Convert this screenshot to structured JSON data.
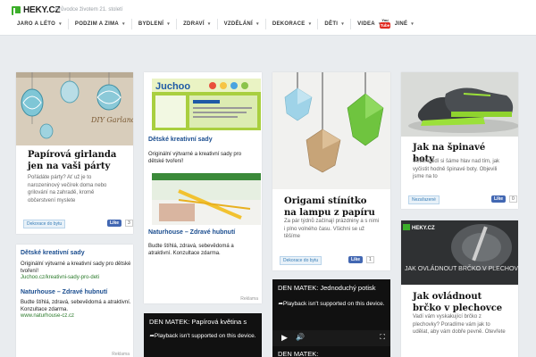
{
  "header": {
    "logo": "HEKY.CZ",
    "tagline": "Průvodce životem 21. století",
    "nav": [
      {
        "label": "JARO A LÉTO"
      },
      {
        "label": "PODZIM A ZIMA"
      },
      {
        "label": "BYDLENÍ"
      },
      {
        "label": "ZDRAVÍ"
      },
      {
        "label": "VZDĚLÁNÍ"
      },
      {
        "label": "DEKORACE"
      },
      {
        "label": "DĚTI"
      },
      {
        "label": "VIDEA"
      },
      {
        "label": "JINÉ"
      }
    ],
    "youtube": {
      "you": "You",
      "tube": "Tube"
    }
  },
  "cards": {
    "girlanda": {
      "image_caption": "DIY Garlands",
      "title": "Papírová girlanda jen na vaši párty",
      "desc": "Pořádáte párty? Ať už je to narozeninový večírek doma nebo grilování na zahradě, kromě občerstvení myslete",
      "tag": "Dekorace do bytu",
      "like": "Like",
      "like_count": "3"
    },
    "ad_middle": {
      "image_label": "Juchoo",
      "link1": "Dětské kreativní sady",
      "text1": "Originální výtvarné a kreativní sady pro dětské tvoření!",
      "link2": "Naturhouse – Zdravé hubnutí",
      "text2": "Budte štíhlá, zdravá, sebevědomá a atraktivní. Konzultace zdarma.",
      "reklama": "Reklama"
    },
    "origami": {
      "title": "Origami stínítko na lampu z papíru",
      "desc": "Za pár týdnů začínají prázdniny a s nimi i plno volného času. Všichni se už těšíme",
      "tag": "Dekorace do bytu",
      "like": "Like",
      "like_count": "1"
    },
    "boty": {
      "title": "Jak na špinavé boty",
      "desc": "Většina lidí si šámе hlav nad tím, jak vyčistit hodně špinavé boty. Objevili jsme na to",
      "tag": "Nezařazené",
      "like": "Like",
      "like_count": "0"
    },
    "ad_left": {
      "link1": "Dětské kreativní sady",
      "text1": "Originální výtvarné a kreativní sady pro dětské tvoření!",
      "url1": "Juchoo.cz/kreativni-sady-pro-deti",
      "link2": "Naturhouse – Zdravé hubnutí",
      "text2": "Budte štíhlá, zdravá, sebevědomá a atraktivní. Konzultace zdarma.",
      "url2": "www.naturhouse-cz.cz",
      "reklama": "Reklama"
    },
    "brcko": {
      "image_logo": "HEKY.CZ",
      "image_text": "JAK OVLÁDNOUT BRČKO V PLECHOVCE",
      "title": "Jak ovládnout brčko v plechovce",
      "desc": "Vadí vám vyskakující brčko z plechovky? Poradíme vám jak to udělat, aby vám dobře pevně. Otevřete"
    }
  },
  "videos": {
    "v1": {
      "title": "DEN MATEK: Papírová květina s",
      "message": "Playback isn't supported on this device."
    },
    "v2": {
      "title": "DEN MATEK: Jednoduchý potisk",
      "message": "Playback isn't supported on this device."
    },
    "v3": {
      "title": "DEN MATEK:"
    }
  },
  "colors": {
    "accent": "#3cae2a",
    "link": "#1a4d8f",
    "facebook": "#4267b2",
    "youtube": "#e02a20"
  }
}
